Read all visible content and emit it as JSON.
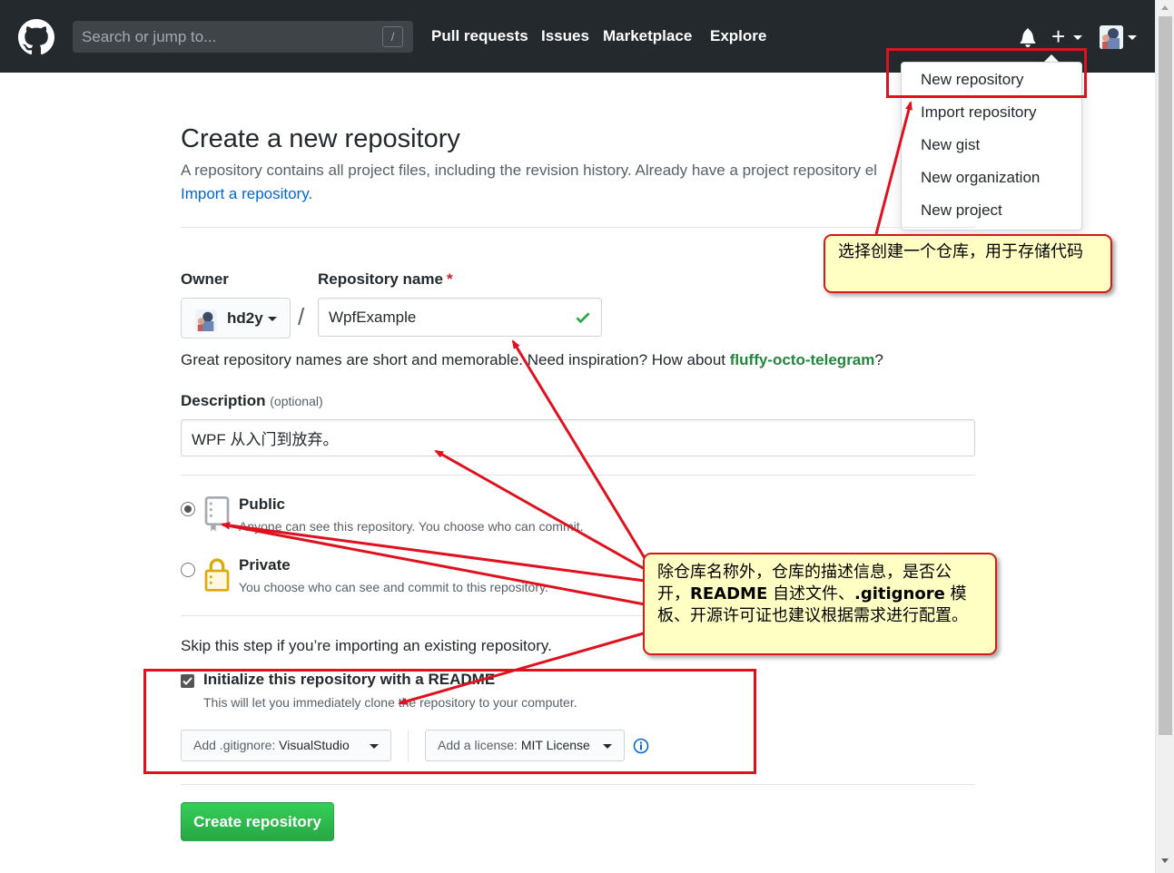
{
  "header": {
    "search_placeholder": "Search or jump to...",
    "slash_key": "/",
    "nav": [
      "Pull requests",
      "Issues",
      "Marketplace",
      "Explore"
    ],
    "plus": "+"
  },
  "dropdown": {
    "items": [
      "New repository",
      "Import repository",
      "New gist",
      "New organization",
      "New project"
    ]
  },
  "main": {
    "title": "Create a new repository",
    "subtitle": "A repository contains all project files, including the revision history. Already have a project repository el",
    "import_link": "Import a repository.",
    "owner_label": "Owner",
    "owner_name": "hd2y",
    "repo_label": "Repository name",
    "required_mark": "*",
    "slash": "/",
    "repo_name": "WpfExample",
    "hint_text": "Great repository names are short and memorable. Need inspiration? How about ",
    "hint_suggestion": "fluffy-octo-telegram",
    "hint_end": "?",
    "desc_label": "Description",
    "desc_optional": "(optional)",
    "description": "WPF 从入门到放弃。",
    "public_title": "Public",
    "public_desc": "Anyone can see this repository. You choose who can commit.",
    "private_title": "Private",
    "private_desc": "You choose who can see and commit to this repository.",
    "skip_text": "Skip this step if you’re importing an existing repository.",
    "init_label": "Initialize this repository with a README",
    "init_desc": "This will let you immediately clone the repository to your computer.",
    "gitignore_prefix": "Add .gitignore: ",
    "gitignore_value": "VisualStudio",
    "license_prefix": "Add a license: ",
    "license_value": "MIT License",
    "create_button": "Create repository"
  },
  "annotations": {
    "callout1": "选择创建一个仓库，用于存储代码",
    "callout2_a": "除仓库名称外，仓库的描述信息，是否公开，",
    "callout2_readme": "README",
    "callout2_b": " 自述文件、",
    "callout2_gitignore": ".gitignore",
    "callout2_c": " 模板、开源许可证也建议根据需求进行配置。"
  },
  "colors": {
    "header_bg": "#24292e",
    "link": "#0366d6",
    "green": "#28a745",
    "annotation_red": "#e0111e",
    "callout_bg": "#ffffc4"
  }
}
